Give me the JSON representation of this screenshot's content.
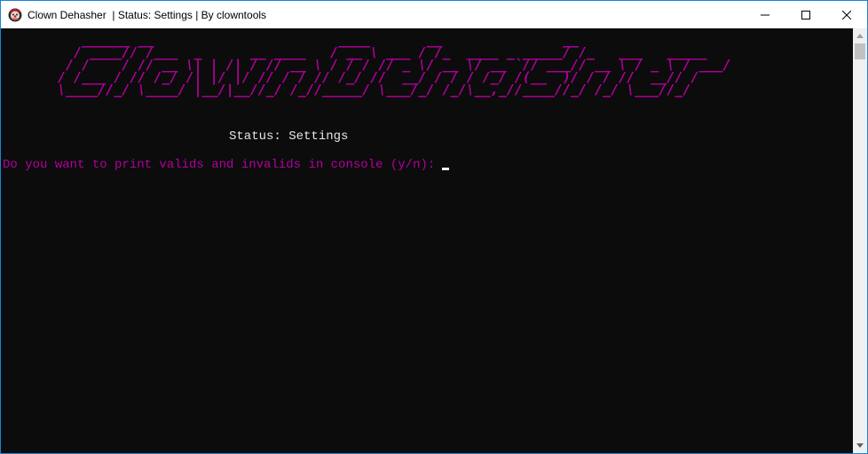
{
  "window": {
    "title": "Clown Dehasher  | Status: Settings | By clowntools",
    "icons": {
      "app": "clown-icon",
      "minimize": "minimize-icon",
      "maximize": "maximize-icon",
      "close": "close-icon"
    },
    "colors": {
      "border": "#1883d7",
      "magenta": "#b4009e",
      "console_bg": "#0c0c0c"
    }
  },
  "console": {
    "banner": "Clown Dehasher",
    "status": "Status: Settings",
    "prompt": "Do you want to print valids and invalids in console (y/n):"
  }
}
